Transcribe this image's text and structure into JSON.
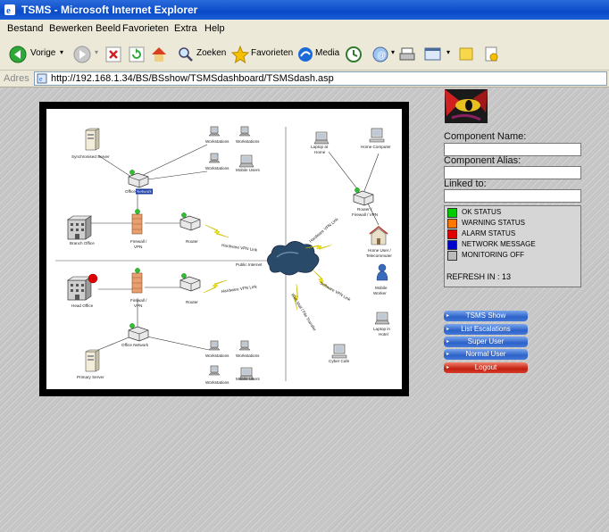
{
  "window": {
    "title": "TSMS - Microsoft Internet Explorer"
  },
  "menu": [
    "Bestand",
    "Bewerken",
    "Beeld",
    "Favorieten",
    "Extra",
    "Help"
  ],
  "toolbar": {
    "back": "Vorige",
    "search": "Zoeken",
    "favorites": "Favorieten",
    "media": "Media"
  },
  "address": {
    "label": "Adres",
    "url": "http://192.168.1.34/BS/BSshow/TSMSdashboard/TSMSdash.asp"
  },
  "diagram": {
    "synch_server": "Synchronised Server",
    "office_network_top_a": "Office",
    "office_network_top_b": "Network",
    "workstations": "Workstations",
    "mobile_users": "Mobile Users",
    "branch_office": "Branch Office",
    "firewall_vpn_a": "Firewall /",
    "firewall_vpn_b": "VPN",
    "router": "Router",
    "hardware_vpn_link": "Hardware VPN Link",
    "public_internet": "Public Internet",
    "head_office": "Head Office",
    "office_network": "Office Network",
    "primary_server": "Primary Server",
    "laptop_home_a": "Laptop at",
    "laptop_home_b": "Home",
    "home_computer": "Home Computer",
    "router_fw_a": "Router /",
    "router_fw_b": "Firewall / VPN",
    "home_user_a": "Home User /",
    "home_user_b": "Telecommuter",
    "mobile_worker_a": "Mobile",
    "mobile_worker_b": "Worker",
    "software_vpn_link": "Software VPN Link",
    "laptop_hotel_a": "Laptop in",
    "laptop_hotel_b": "Hotel",
    "web_mail": "Web Mail / File Transfer",
    "cyber_cafe": "Cyber Cafe"
  },
  "panel": {
    "component_name_label": "Component Name:",
    "component_alias_label": "Component Alias:",
    "linked_to_label": "Linked to:",
    "component_name_value": "",
    "component_alias_value": "",
    "linked_to_value": ""
  },
  "legend": [
    {
      "label": "OK STATUS",
      "color": "#00cc00"
    },
    {
      "label": "WARNING STATUS",
      "color": "#ff7700"
    },
    {
      "label": "ALARM STATUS",
      "color": "#dd0000"
    },
    {
      "label": "NETWORK MESSAGE",
      "color": "#0000cc"
    },
    {
      "label": "MONITORING OFF",
      "color": "#bbbbbb"
    }
  ],
  "refresh": "REFRESH IN : 13",
  "nav": [
    "TSMS Show",
    "List Escalations",
    "Super User",
    "Normal User",
    "Logout"
  ]
}
